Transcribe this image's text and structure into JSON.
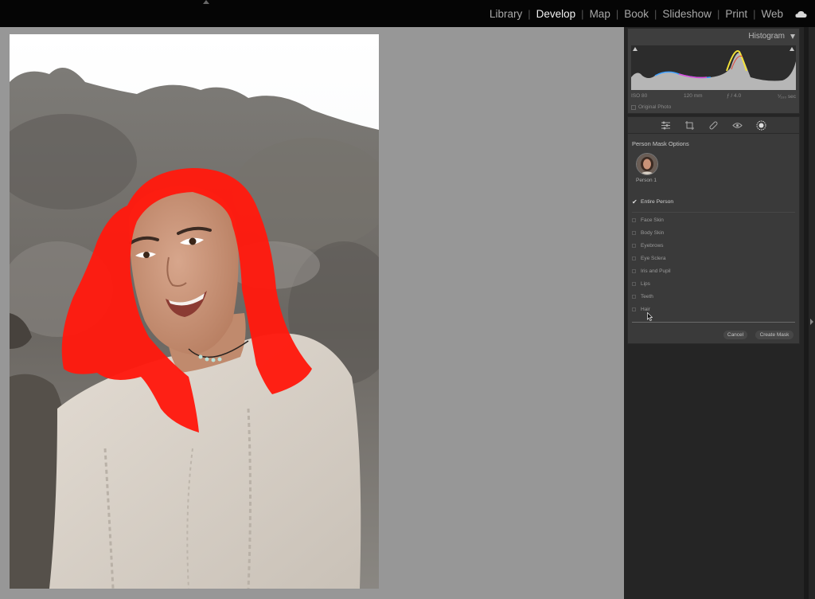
{
  "modules": [
    "Library",
    "Develop",
    "Map",
    "Book",
    "Slideshow",
    "Print",
    "Web"
  ],
  "active_module": "Develop",
  "histogram": {
    "title": "Histogram",
    "iso": "ISO 80",
    "focal": "120 mm",
    "aperture": "ƒ / 4.0",
    "shutter": "⅟₁₀₀ sec",
    "original_photo": "Original Photo"
  },
  "tools": [
    "sliders-icon",
    "crop-icon",
    "healing-icon",
    "redeye-icon",
    "masking-icon"
  ],
  "mask": {
    "title": "Person Mask Options",
    "person": "Person 1",
    "entire_person": "Entire Person",
    "options": [
      "Face Skin",
      "Body Skin",
      "Eyebrows",
      "Eye Sclera",
      "Iris and Pupil",
      "Lips",
      "Teeth",
      "Hair"
    ],
    "cancel": "Cancel",
    "create": "Create Mask",
    "overlay_color": "#ff1a0e"
  }
}
